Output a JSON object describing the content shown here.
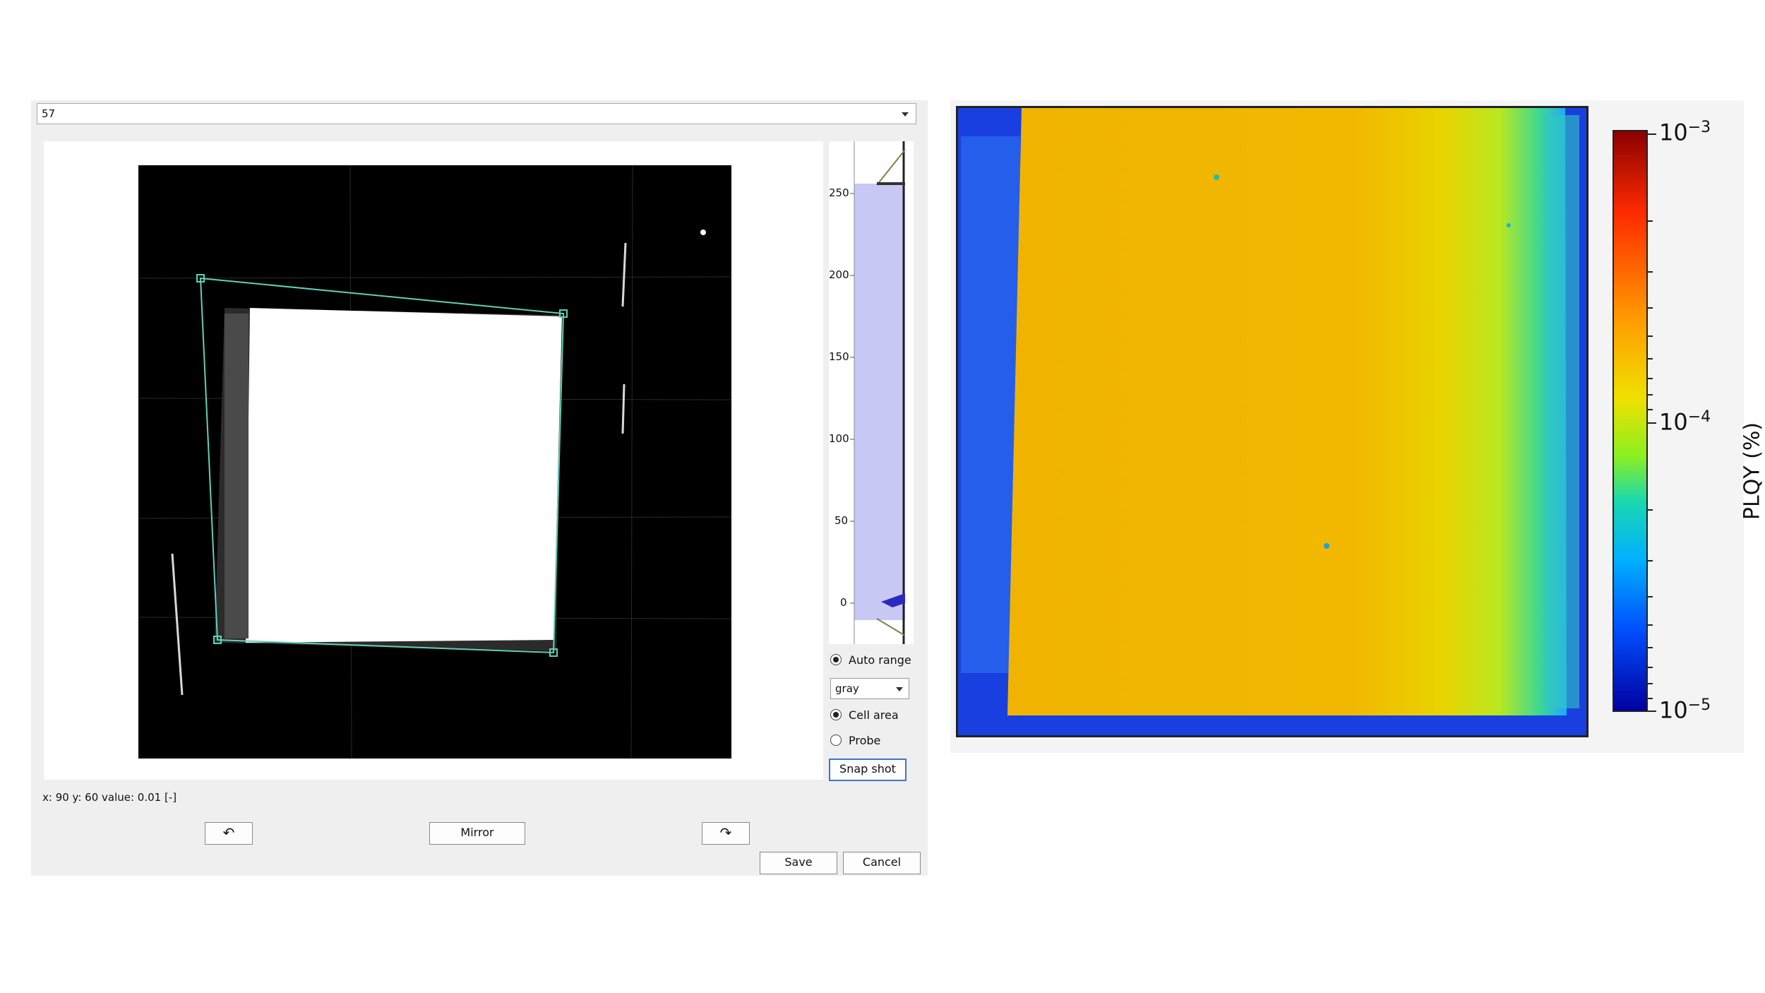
{
  "dialog": {
    "selector_value": "57",
    "histogram_ticks": [
      "250",
      "200",
      "150",
      "100",
      "50",
      "0"
    ],
    "auto_range_label": "Auto range",
    "auto_range_checked": true,
    "colormap_value": "gray",
    "cell_area_label": "Cell area",
    "cell_area_selected": true,
    "probe_label": "Probe",
    "probe_selected": false,
    "snapshot_label": "Snap shot",
    "status": "x:  90  y:  60  value:  0.01  [-]",
    "rotate_left_label": "↶",
    "mirror_label": "Mirror",
    "rotate_right_label": "↷",
    "save_label": "Save",
    "cancel_label": "Cancel"
  },
  "figure": {
    "colorbar_title": "PLQY (%)",
    "colorbar_ticks": [
      {
        "base": "10",
        "exp": "−3"
      },
      {
        "base": "10",
        "exp": "−4"
      },
      {
        "base": "10",
        "exp": "−5"
      }
    ],
    "colorbar_scale": "log",
    "colormap": "jet"
  },
  "colors": {
    "roi_outline": "#5fd0b8",
    "histogram_fill": "#c8c8f4",
    "map_fill": "#f0b400",
    "map_edge": "#1a3fe0"
  }
}
